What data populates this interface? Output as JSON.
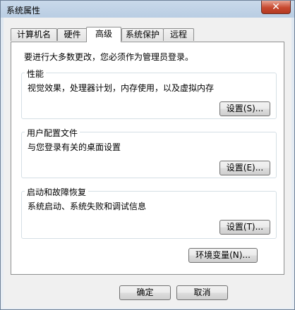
{
  "window": {
    "title": "系统属性"
  },
  "tabs": [
    {
      "label": "计算机名"
    },
    {
      "label": "硬件"
    },
    {
      "label": "高级"
    },
    {
      "label": "系统保护"
    },
    {
      "label": "远程"
    }
  ],
  "intro_text": "要进行大多数更改，您必须作为管理员登录。",
  "groups": {
    "performance": {
      "title": "性能",
      "desc": "视觉效果，处理器计划，内存使用，以及虚拟内存",
      "button": "设置(S)..."
    },
    "profile": {
      "title": "用户配置文件",
      "desc": "与您登录有关的桌面设置",
      "button": "设置(E)..."
    },
    "startup": {
      "title": "启动和故障恢复",
      "desc": "系统启动、系统失败和调试信息",
      "button": "设置(T)..."
    }
  },
  "env_button": "环境变量(N)...",
  "footer": {
    "ok": "确定",
    "cancel": "取消"
  }
}
